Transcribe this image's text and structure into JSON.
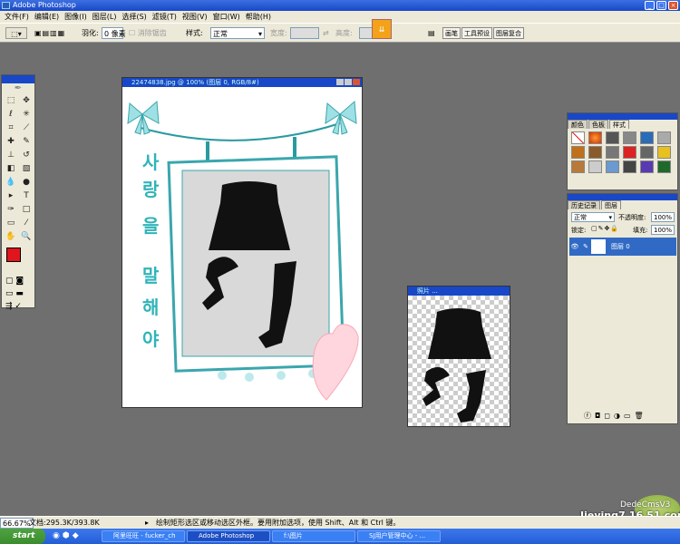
{
  "window": {
    "title": "Adobe Photoshop"
  },
  "menu": [
    "文件(F)",
    "编辑(E)",
    "图像(I)",
    "图层(L)",
    "选择(S)",
    "滤镜(T)",
    "视图(V)",
    "窗口(W)",
    "帮助(H)"
  ],
  "options": {
    "feather_label": "羽化:",
    "feather_value": "0 像素",
    "antialias_label": "消除锯齿",
    "style_label": "样式:",
    "style_value": "正常",
    "width_label": "宽度:",
    "height_label": "高度:",
    "tabs": [
      "画笔",
      "工具预设",
      "图层复合"
    ]
  },
  "colors": {
    "foreground": "#e0151d",
    "background": "#e0151d",
    "accent_blue": "#1848c8"
  },
  "documents": {
    "main": {
      "title": "22474838.jpg @ 100% (图层 0, RGB/8#)"
    },
    "small": {
      "title": "照片 ..."
    }
  },
  "styles_panel": {
    "tabs": [
      "颜色",
      "色板",
      "样式"
    ]
  },
  "layers_panel": {
    "tabs": [
      "历史记录",
      "图层"
    ],
    "blend_mode": "正常",
    "opacity_label": "不透明度:",
    "opacity_value": "100%",
    "lock_label": "锁定:",
    "fill_label": "填充:",
    "fill_value": "100%",
    "layer_name": "图层 0"
  },
  "status": {
    "zoom": "66.67%",
    "doc_info": "文档:295.3K/393.8K",
    "hint": "绘制矩形选区或移动选区外框。要用附加选项，使用 Shift、Alt 和 Ctrl 键。"
  },
  "taskbar": {
    "start": "start",
    "tasks": [
      "阿里旺旺 - fucker_ch",
      "Adobe Photoshop",
      "f:\\图片",
      "SJ用户管理中心 - ..."
    ]
  },
  "watermark": {
    "line1": "DedeCmsV3",
    "line2": "Jieying7.16.51.com"
  }
}
